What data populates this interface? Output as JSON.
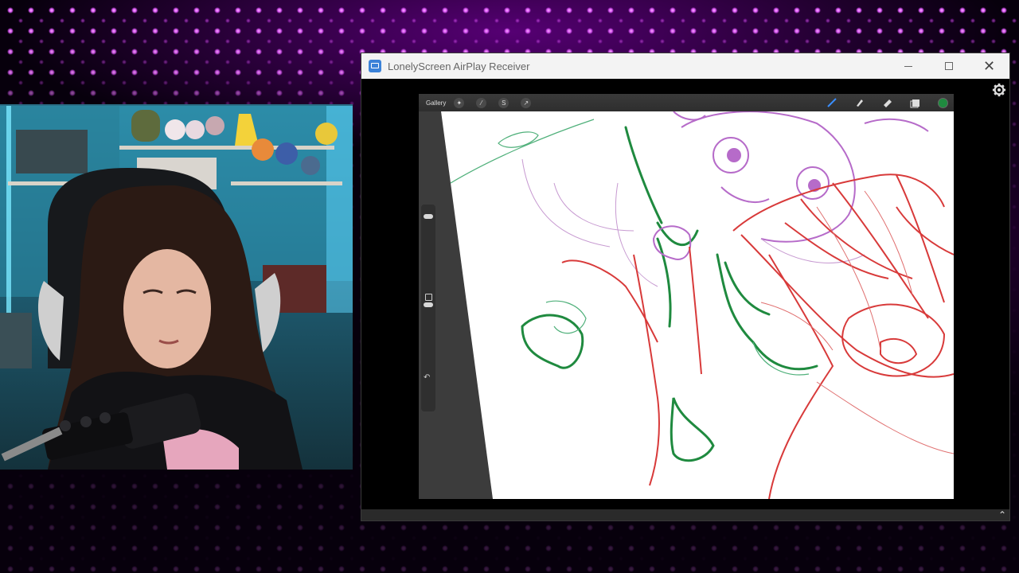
{
  "window": {
    "title": "LonelyScreen AirPlay Receiver",
    "controls": {
      "minimize": "minimize",
      "maximize": "maximize",
      "close": "✕"
    }
  },
  "procreate": {
    "gallery_label": "Gallery",
    "tools_left": [
      "wrench-icon",
      "magic-wand-icon",
      "selection-icon",
      "transform-icon"
    ],
    "tools_right": [
      "brush-icon",
      "smudge-icon",
      "eraser-icon",
      "layers-icon"
    ],
    "active_color": "#1f8a3f",
    "undo_glyph": "↶"
  },
  "colors": {
    "sketch_red": "#d83a3a",
    "sketch_green": "#1f8a3f",
    "sketch_purple": "#b66bc9",
    "backdrop_purple": "#e35bff"
  },
  "icons": {
    "settings": "gear-icon",
    "bottom_bar": "chevron-up-icon"
  }
}
